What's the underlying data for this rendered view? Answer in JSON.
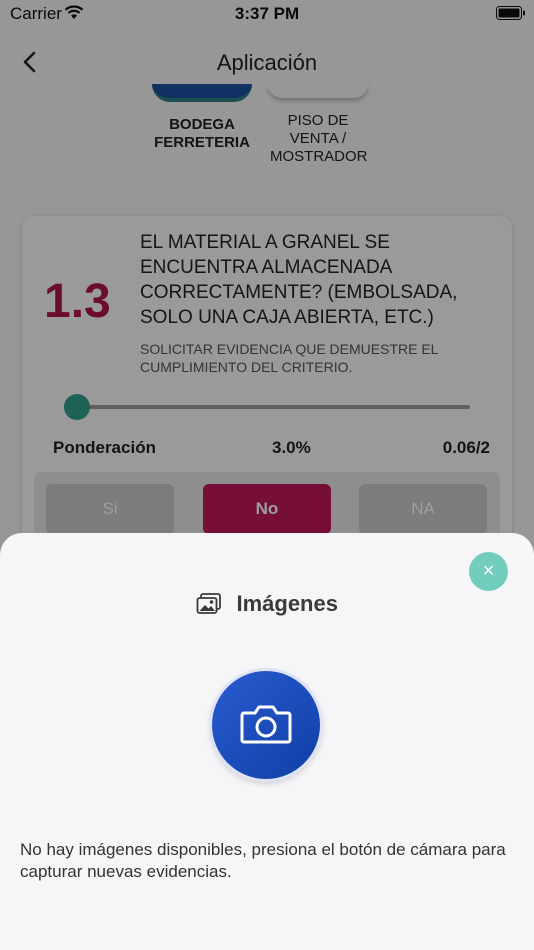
{
  "status_bar": {
    "carrier": "Carrier",
    "time": "3:37 PM"
  },
  "nav": {
    "title": "Aplicación"
  },
  "areas": [
    {
      "label": "BODEGA FERRETERIA"
    },
    {
      "label": "PISO DE VENTA / MOSTRADOR"
    }
  ],
  "question": {
    "number": "1.3",
    "text": "EL MATERIAL A GRANEL SE ENCUENTRA ALMACENADA CORRECTAMENTE? (EMBOLSADA, SOLO UNA CAJA ABIERTA, ETC.)",
    "hint": "SOLICITAR EVIDENCIA QUE DEMUESTRE EL CUMPLIMIENTO DEL CRITERIO.",
    "ponderacion_label": "Ponderación",
    "ponderacion_pct": "3.0%",
    "score": "0.06/2",
    "answers": [
      "Si",
      "No",
      "NA"
    ],
    "selected_answer": "No"
  },
  "modal": {
    "close_label": "×",
    "title": "Imágenes",
    "empty_message": "No hay imágenes disponibles, presiona el botón de cámara para capturar nuevas evidencias."
  },
  "colors": {
    "accent": "#c0185a",
    "teal": "#72cdbe",
    "camera_blue": "#1d4fc0"
  },
  "icons": {
    "back": "chevron-left-icon",
    "close": "close-icon",
    "title": "image-icon",
    "camera": "camera-icon"
  }
}
